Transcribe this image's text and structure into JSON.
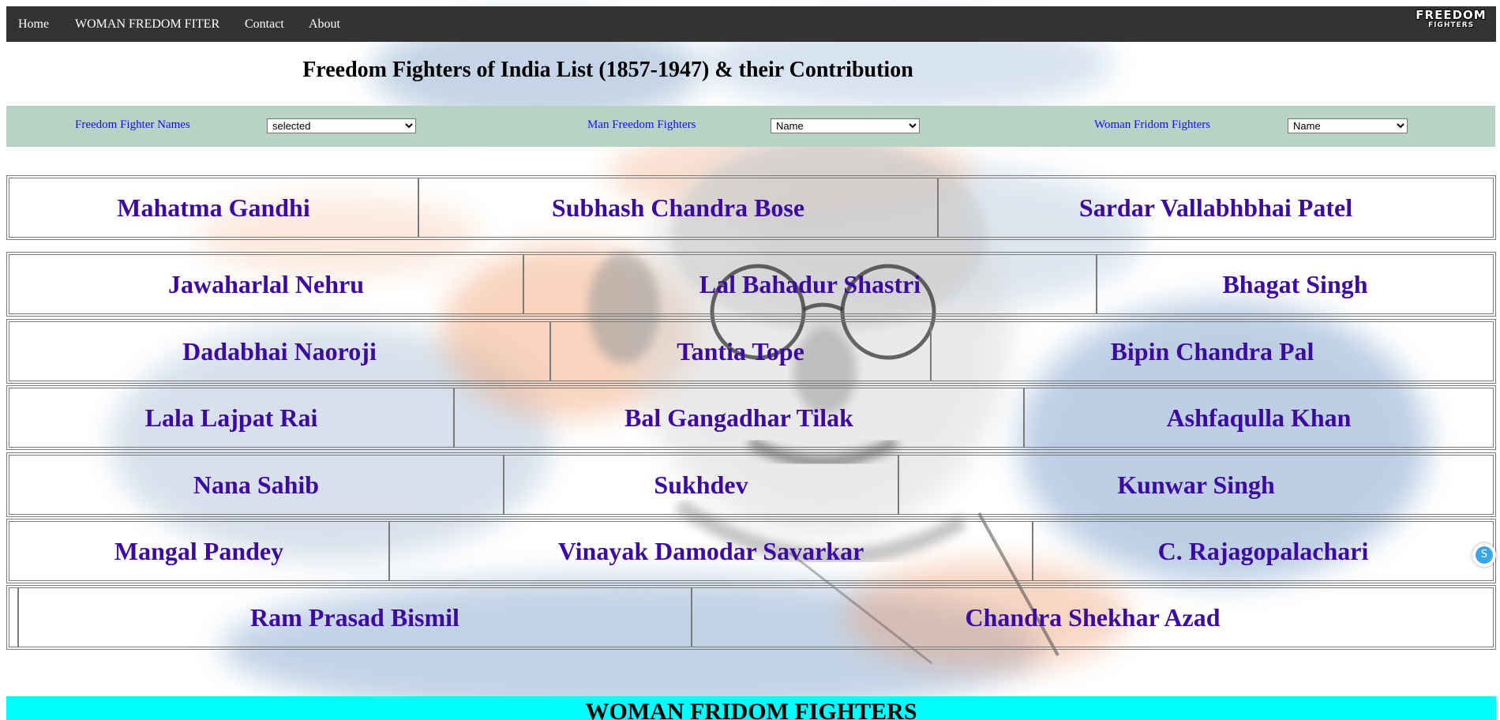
{
  "nav": {
    "items": [
      {
        "label": "Home"
      },
      {
        "label": "WOMAN FREDOM FITER"
      },
      {
        "label": "Contact"
      },
      {
        "label": "About"
      }
    ],
    "logo": {
      "line1": "FREEDOM",
      "line2": "FIGHTERS"
    }
  },
  "page": {
    "title": "Freedom Fighters of India List (1857-1947) & their Contribution"
  },
  "filters": {
    "names": {
      "label": "Freedom Fighter Names",
      "selected": "selected"
    },
    "man": {
      "label": "Man Freedom Fighters",
      "selected": "Name"
    },
    "woman": {
      "label": "Woman Fridom Fighters",
      "selected": "Name"
    }
  },
  "fighters": {
    "rows": [
      [
        "Mahatma Gandhi",
        "Subhash Chandra Bose",
        "Sardar Vallabhbhai Patel"
      ],
      [
        "Jawaharlal Nehru",
        "Lal Bahadur Shastri",
        "Bhagat Singh"
      ],
      [
        "Dadabhai Naoroji",
        "Tantia Tope",
        "Bipin Chandra Pal"
      ],
      [
        "Lala Lajpat Rai",
        "Bal Gangadhar Tilak",
        "Ashfaqulla Khan"
      ],
      [
        "Nana Sahib",
        "Sukhdev",
        "Kunwar Singh"
      ],
      [
        "Mangal Pandey",
        "Vinayak Damodar Savarkar",
        "C. Rajagopalachari"
      ],
      [
        "Ram Prasad Bismil",
        "Chandra Shekhar Azad"
      ]
    ]
  },
  "section": {
    "woman_heading": "WOMAN FRIDOM FIGHTERS"
  },
  "floating": {
    "icon": "S"
  },
  "colors": {
    "nav_bg": "#333333",
    "filter_bg": "#b9d2c6",
    "filter_text": "#1a0aff",
    "name_text": "#3c0aa0",
    "woman_bar": "#00ffff"
  }
}
